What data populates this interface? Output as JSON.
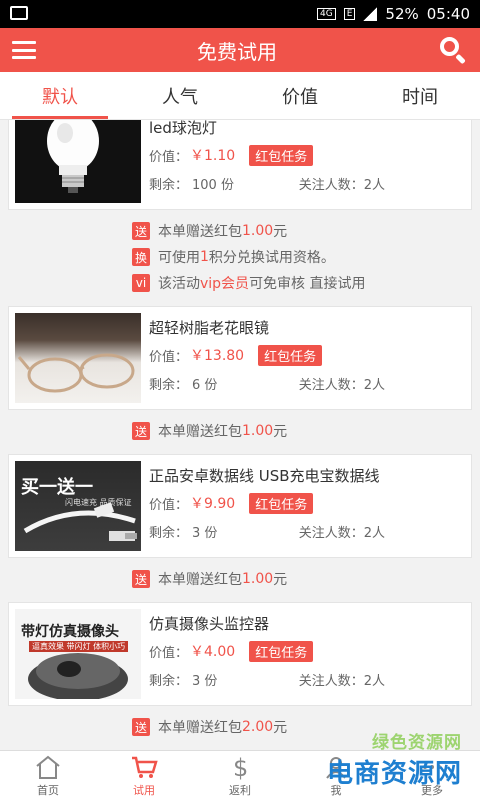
{
  "statusbar": {
    "battery": "52%",
    "time": "05:40",
    "net1": "4G",
    "net2": "E"
  },
  "header": {
    "title": "免费试用"
  },
  "tabs": [
    "默认",
    "人气",
    "价值",
    "时间"
  ],
  "labels": {
    "price_prefix": "价值：",
    "remain_prefix": "剩余：",
    "follow_prefix": "关注人数："
  },
  "items": [
    {
      "name": "led球泡灯",
      "price": "￥1.10",
      "badge": "红包任务",
      "remain": "100 份",
      "follow": "2人",
      "extras": [
        {
          "tag": "送",
          "pre": "本单赠送红包",
          "hl": "1.00",
          "post": "元"
        },
        {
          "tag": "换",
          "pre": "可使用",
          "hl": "1",
          "post": "积分兑换试用资格。"
        },
        {
          "tag": "vi",
          "pre": "该活动",
          "hl": "vip会员",
          "post": "可免审核 直接试用"
        }
      ]
    },
    {
      "name": "超轻树脂老花眼镜",
      "price": "￥13.80",
      "badge": "红包任务",
      "remain": "6 份",
      "follow": "2人",
      "extras": [
        {
          "tag": "送",
          "pre": "本单赠送红包",
          "hl": "1.00",
          "post": "元"
        }
      ]
    },
    {
      "name": "正品安卓数据线 USB充电宝数据线",
      "price": "￥9.90",
      "badge": "红包任务",
      "remain": "3 份",
      "follow": "2人",
      "thumb_text": "买一送一",
      "thumb_sub": "闪电速充 品质保证",
      "extras": [
        {
          "tag": "送",
          "pre": "本单赠送红包",
          "hl": "1.00",
          "post": "元"
        }
      ]
    },
    {
      "name": "仿真摄像头监控器",
      "price": "￥4.00",
      "badge": "红包任务",
      "remain": "3 份",
      "follow": "2人",
      "thumb_text": "带灯仿真摄像头",
      "thumb_sub": "逼真效果 带闪灯 体积小巧",
      "extras": [
        {
          "tag": "送",
          "pre": "本单赠送红包",
          "hl": "2.00",
          "post": "元"
        }
      ]
    }
  ],
  "nav": [
    {
      "label": "首页",
      "icon": "home-icon"
    },
    {
      "label": "试用",
      "icon": "cart-icon"
    },
    {
      "label": "返利",
      "icon": "dollar-icon"
    },
    {
      "label": "我",
      "icon": "user-icon"
    },
    {
      "label": "更多",
      "icon": "more-icon"
    }
  ],
  "watermark": {
    "line1": "绿色资源网",
    "line2": "电商资源网"
  }
}
